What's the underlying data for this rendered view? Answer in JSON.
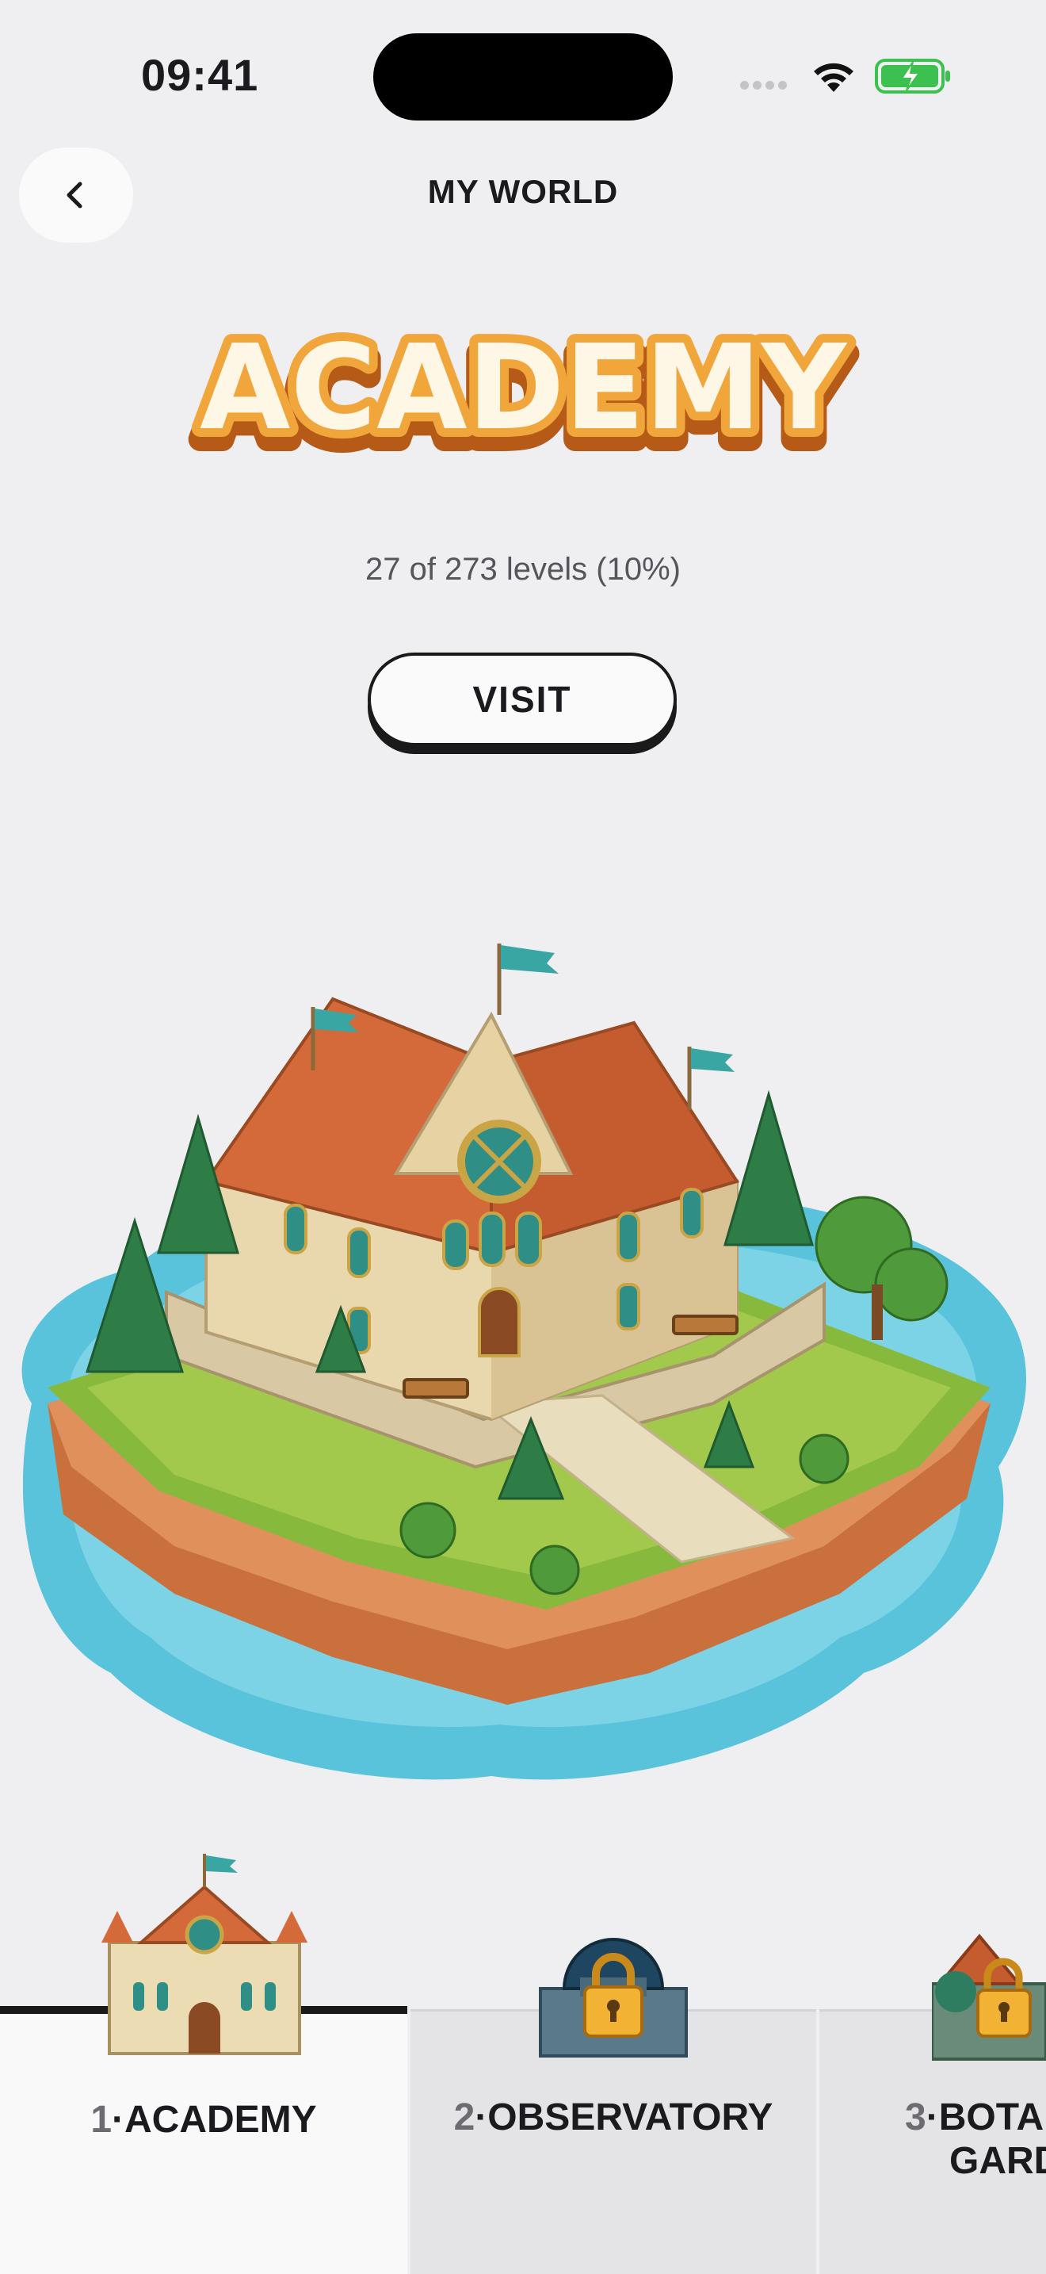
{
  "status_bar": {
    "time": "09:41"
  },
  "header": {
    "title": "MY WORLD",
    "back_icon": "chevron-left-icon"
  },
  "world": {
    "name": "ACADEMY",
    "progress_text": "27 of 273 levels (10%)",
    "levels_completed": 27,
    "levels_total": 273,
    "visit_label": "VISIT"
  },
  "tabs": [
    {
      "number": "1",
      "name": "ACADEMY",
      "selected": true,
      "locked": false
    },
    {
      "number": "2",
      "name": "OBSERVATORY",
      "selected": false,
      "locked": true
    },
    {
      "number": "3",
      "name": "BOTAN",
      "name_line2": "GARD",
      "selected": false,
      "locked": true
    }
  ],
  "colors": {
    "background": "#efeff2",
    "title_fill": "#fff3d6",
    "title_outline": "#c1651d",
    "water": "#59c3dc",
    "roof": "#d4693a",
    "battery_green": "#3cc04f"
  }
}
